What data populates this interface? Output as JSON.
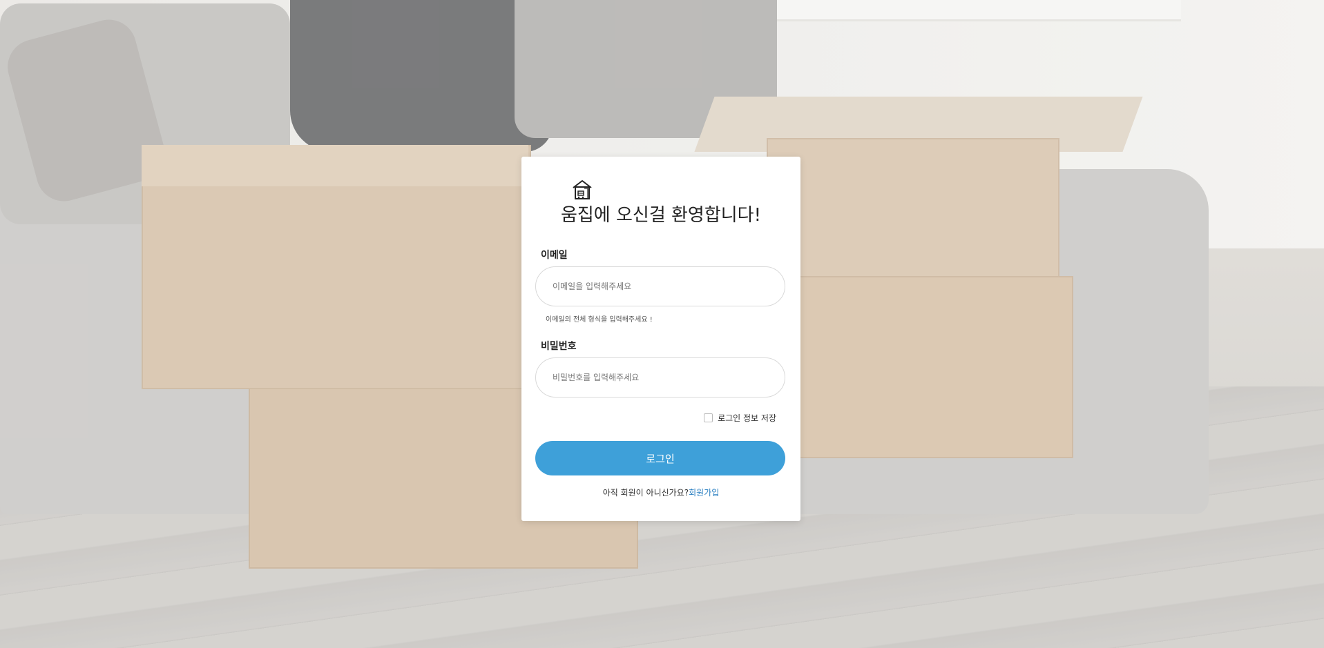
{
  "login": {
    "title": "움집에 오신걸 환영합니다!",
    "email_label": "이메일",
    "email_placeholder": "이메일을 입력해주세요",
    "email_hint": "이메일의 전체 형식을 입력해주세요 !",
    "password_label": "비밀번호",
    "password_placeholder": "비밀번호를 입력해주세요",
    "remember_label": "로그인 정보 저장",
    "remember_checked": false,
    "login_button": "로그인",
    "signup_prompt": "아직 회원이 아니신가요?",
    "signup_link": "회원가입"
  },
  "icons": {
    "logo": "house-logo-icon",
    "checkbox": "checkbox-icon"
  },
  "colors": {
    "accent": "#3ea0d9",
    "link": "#2a7fc1",
    "card_bg": "#ffffff"
  }
}
